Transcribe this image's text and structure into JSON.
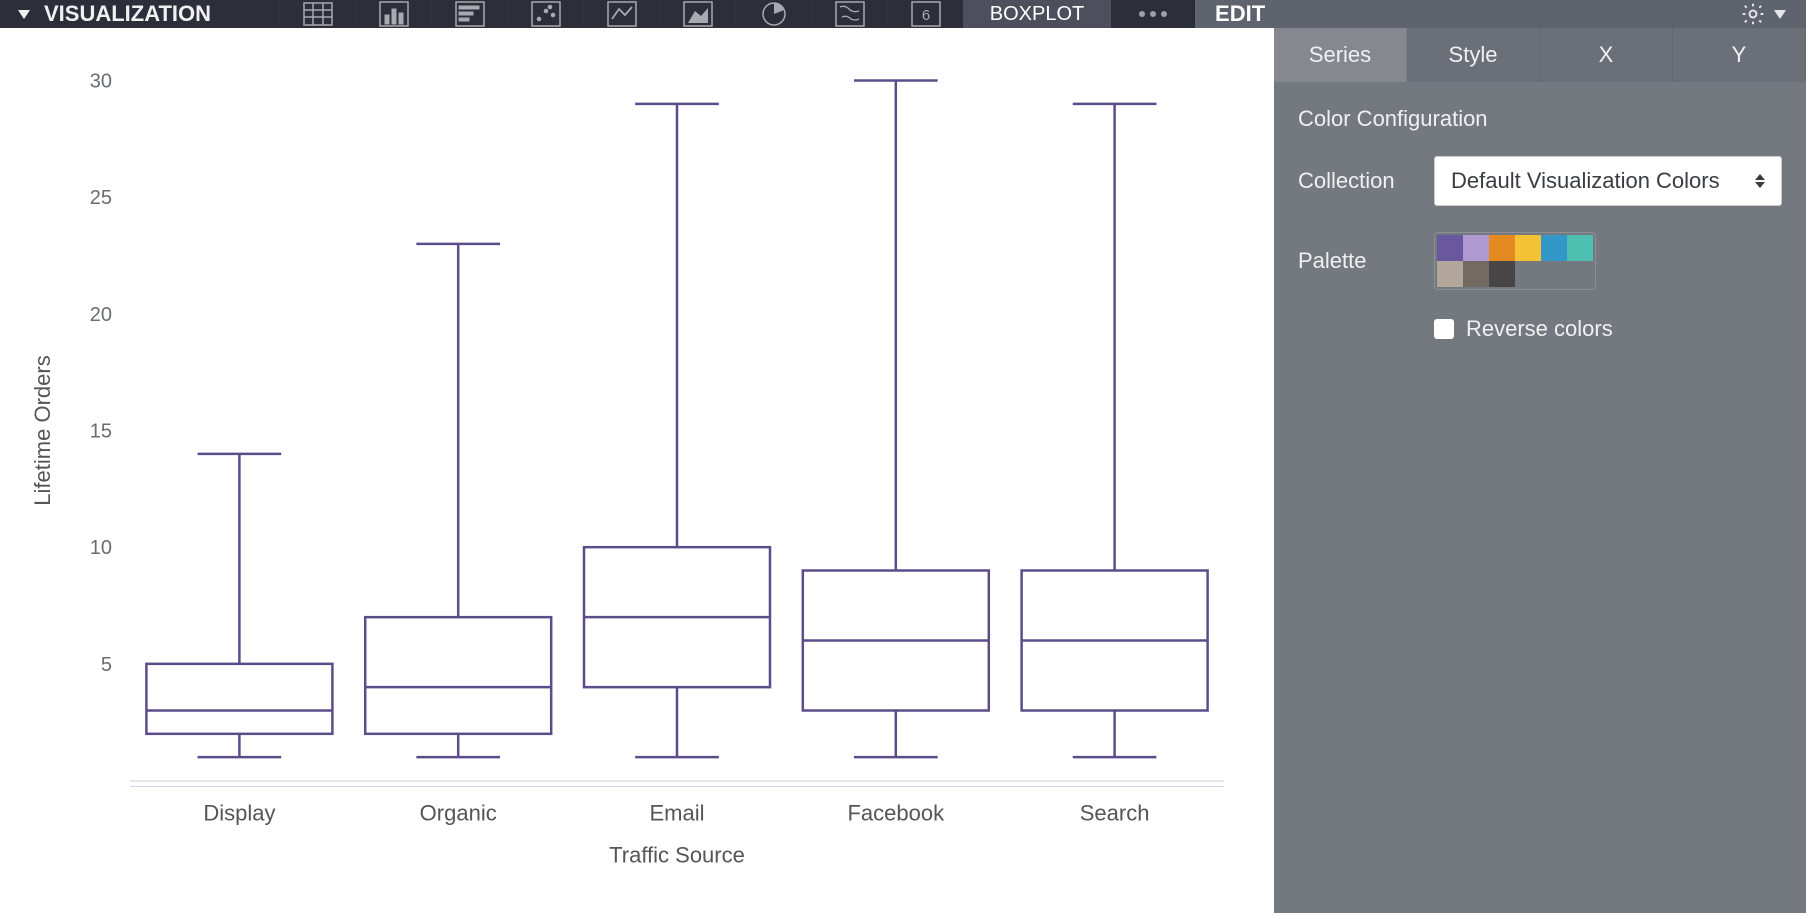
{
  "topbar": {
    "title": "VISUALIZATION",
    "active_tab": "BOXPLOT"
  },
  "edit": {
    "title": "EDIT",
    "tabs": {
      "series": "Series",
      "style": "Style",
      "x": "X",
      "y": "Y"
    },
    "section": "Color Configuration",
    "collection_label": "Collection",
    "collection_value": "Default Visualization Colors",
    "palette_label": "Palette",
    "reverse_label": "Reverse colors",
    "palette_colors": [
      "#6a589f",
      "#ae9ad1",
      "#e58a23",
      "#f3c235",
      "#3398c8",
      "#4dc0b1",
      "#b3a79c",
      "#736b62",
      "#474545",
      "#74787f",
      "#74787f",
      "#74787f"
    ]
  },
  "chart_data": {
    "type": "boxplot",
    "title": "",
    "xlabel": "Traffic Source",
    "ylabel": "Lifetime Orders",
    "ylim": [
      0,
      30
    ],
    "yticks": [
      5,
      10,
      15,
      20,
      25,
      30
    ],
    "categories": [
      "Display",
      "Organic",
      "Email",
      "Facebook",
      "Search"
    ],
    "series": [
      {
        "category": "Display",
        "min": 1,
        "q1": 2,
        "median": 3,
        "q3": 5,
        "max": 14
      },
      {
        "category": "Organic",
        "min": 1,
        "q1": 2,
        "median": 4,
        "q3": 7,
        "max": 23
      },
      {
        "category": "Email",
        "min": 1,
        "q1": 4,
        "median": 7,
        "q3": 10,
        "max": 29
      },
      {
        "category": "Facebook",
        "min": 1,
        "q1": 3,
        "median": 6,
        "q3": 9,
        "max": 30
      },
      {
        "category": "Search",
        "min": 1,
        "q1": 3,
        "median": 6,
        "q3": 9,
        "max": 29
      }
    ]
  }
}
